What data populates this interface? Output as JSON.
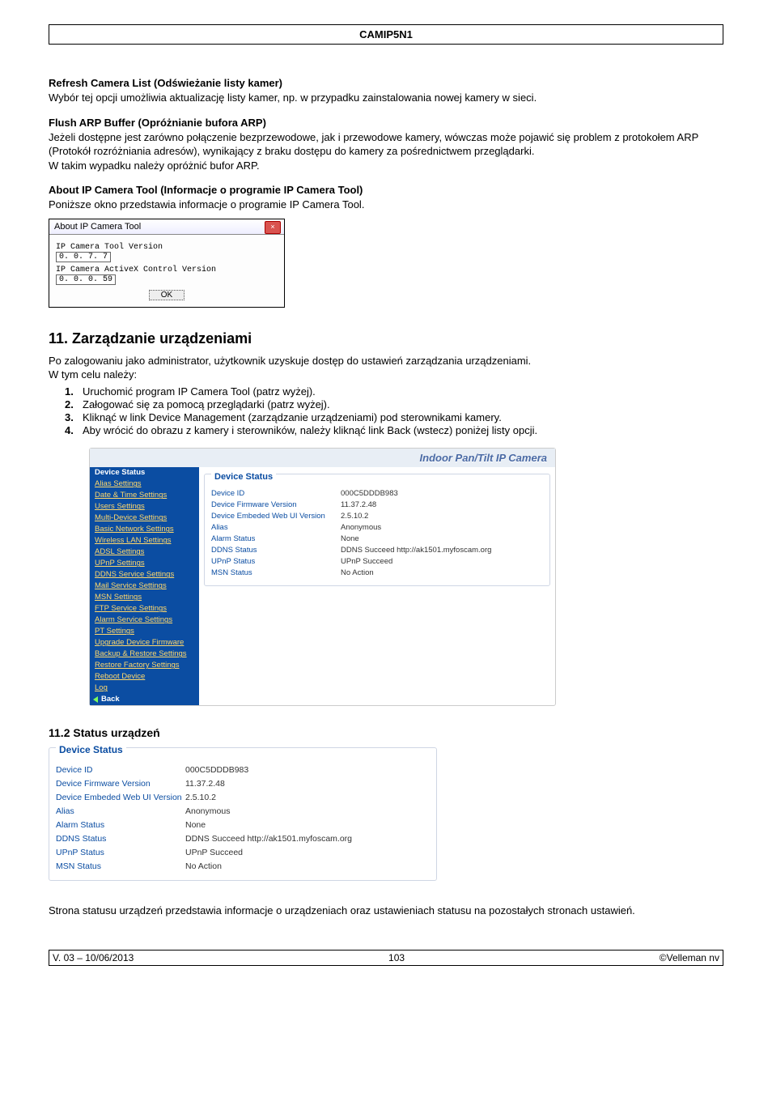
{
  "header": {
    "title": "CAMIP5N1"
  },
  "refresh": {
    "title": "Refresh Camera List (Odświeżanie listy kamer)",
    "text": "Wybór tej opcji umożliwia aktualizację listy kamer, np. w przypadku zainstalowania nowej kamery w sieci."
  },
  "flush": {
    "title": "Flush ARP Buffer (Opróżnianie bufora ARP)",
    "text1": "Jeżeli dostępne jest zarówno połączenie bezprzewodowe, jak i przewodowe kamery, wówczas może pojawić się problem z protokołem ARP (Protokół rozróżniania adresów), wynikający z braku dostępu do kamery za pośrednictwem przeglądarki.",
    "text2": "W takim wypadku należy opróżnić bufor ARP."
  },
  "about": {
    "title": "About IP Camera Tool (Informacje o programie IP Camera Tool)",
    "text": "Poniższe okno przedstawia informacje o programie IP Camera Tool.",
    "dlg_title": "About IP Camera Tool",
    "row1_label": "IP Camera Tool Version",
    "row1_val": "0. 0. 7. 7",
    "row2_label": "IP Camera ActiveX Control Version",
    "row2_val": "0. 0. 0. 59",
    "ok": "OK"
  },
  "sec11": {
    "title": "11.   Zarządzanie urządzeniami",
    "intro1": "Po zalogowaniu jako administrator, użytkownik uzyskuje dostęp do ustawień zarządzania urządzeniami.",
    "intro2": "W tym celu należy:",
    "steps": [
      "Uruchomić program IP Camera Tool (patrz wyżej).",
      "Załogować się za pomocą przeglądarki (patrz wyżej).",
      "Kliknąć w link Device Management (zarządzanie urządzeniami) pod sterownikami kamery.",
      "Aby wrócić do obrazu z kamery i sterowników, należy kliknąć link Back (wstecz) poniżej listy opcji."
    ]
  },
  "devmgmt": {
    "head": "Indoor Pan/Tilt IP Camera",
    "side": [
      "Device Status",
      "Alias Settings",
      "Date & Time Settings",
      "Users Settings",
      "Multi-Device Settings",
      "Basic Network Settings",
      "Wireless LAN Settings",
      "ADSL Settings",
      "UPnP Settings",
      "DDNS Service Settings",
      "Mail Service Settings",
      "MSN Settings",
      "FTP Service Settings",
      "Alarm Service Settings",
      "PT Settings",
      "Upgrade Device Firmware",
      "Backup & Restore Settings",
      "Restore Factory Settings",
      "Reboot Device",
      "Log"
    ],
    "back": "Back",
    "panel_title": "Device Status",
    "rows": [
      {
        "k": "Device ID",
        "v": "000C5DDDB983"
      },
      {
        "k": "Device Firmware Version",
        "v": "11.37.2.48"
      },
      {
        "k": "Device Embeded Web UI Version",
        "v": "2.5.10.2"
      },
      {
        "k": "Alias",
        "v": "Anonymous"
      },
      {
        "k": "Alarm Status",
        "v": "None"
      },
      {
        "k": "DDNS Status",
        "v": "DDNS Succeed  http://ak1501.myfoscam.org"
      },
      {
        "k": "UPnP Status",
        "v": "UPnP Succeed"
      },
      {
        "k": "MSN Status",
        "v": "No Action"
      }
    ]
  },
  "sec112": {
    "title": "11.2  Status urządzeń",
    "panel_title": "Device Status",
    "rows": [
      {
        "k": "Device ID",
        "v": "000C5DDDB983"
      },
      {
        "k": "Device Firmware Version",
        "v": "11.37.2.48"
      },
      {
        "k": "Device Embeded Web UI Version",
        "v": "2.5.10.2"
      },
      {
        "k": "Alias",
        "v": "Anonymous"
      },
      {
        "k": "Alarm Status",
        "v": "None"
      },
      {
        "k": "DDNS Status",
        "v": "DDNS Succeed  http://ak1501.myfoscam.org"
      },
      {
        "k": "UPnP Status",
        "v": "UPnP Succeed"
      },
      {
        "k": "MSN Status",
        "v": "No Action"
      }
    ],
    "after": "Strona statusu urządzeń przedstawia informacje o urządzeniach oraz ustawieniach statusu na pozostałych stronach ustawień."
  },
  "footer": {
    "left": "V. 03 – 10/06/2013",
    "center": "103",
    "right": "©Velleman nv"
  }
}
